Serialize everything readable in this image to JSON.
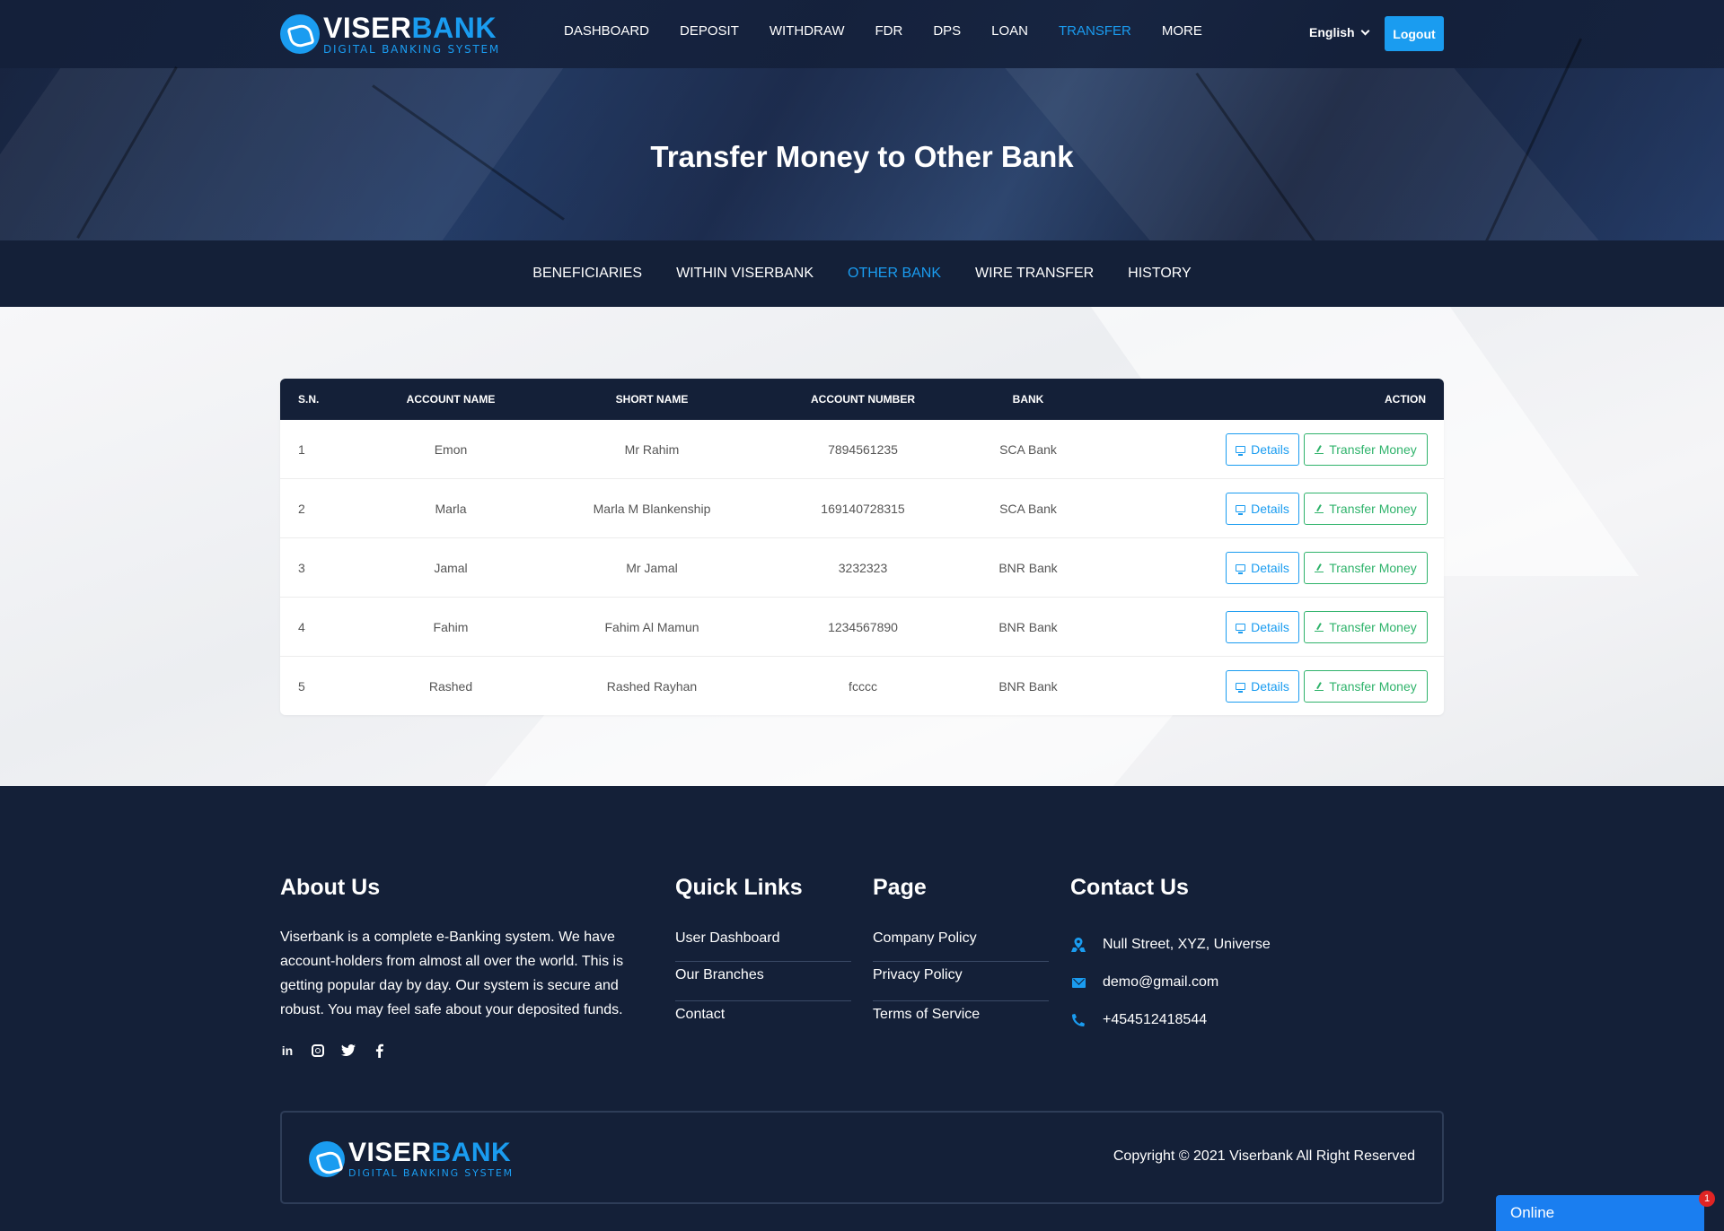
{
  "brand": {
    "word1": "VISER",
    "word2": "BANK",
    "tagline": "DIGITAL BANKING SYSTEM",
    "accent": "#1a9cf0",
    "navy": "#142038",
    "green": "#2fb36b"
  },
  "nav": {
    "items": [
      "DASHBOARD",
      "DEPOSIT",
      "WITHDRAW",
      "FDR",
      "DPS",
      "LOAN",
      "TRANSFER",
      "MORE"
    ],
    "active": "TRANSFER"
  },
  "language": {
    "selected": "English"
  },
  "logout_label": "Logout",
  "hero": {
    "title": "Transfer Money to Other Bank"
  },
  "subnav": {
    "items": [
      "BENEFICIARIES",
      "WITHIN VISERBANK",
      "OTHER BANK",
      "WIRE TRANSFER",
      "HISTORY"
    ],
    "active": "OTHER BANK"
  },
  "table": {
    "headers": {
      "sn": "S.N.",
      "account_name": "ACCOUNT NAME",
      "short_name": "SHORT NAME",
      "account_number": "ACCOUNT NUMBER",
      "bank": "BANK",
      "action": "ACTION"
    },
    "details_label": "Details",
    "transfer_label": "Transfer Money",
    "rows": [
      {
        "sn": "1",
        "account_name": "Emon",
        "short_name": "Mr Rahim",
        "account_number": "7894561235",
        "bank": "SCA Bank"
      },
      {
        "sn": "2",
        "account_name": "Marla",
        "short_name": "Marla M Blankenship",
        "account_number": "169140728315",
        "bank": "SCA Bank"
      },
      {
        "sn": "3",
        "account_name": "Jamal",
        "short_name": "Mr Jamal",
        "account_number": "3232323",
        "bank": "BNR Bank"
      },
      {
        "sn": "4",
        "account_name": "Fahim",
        "short_name": "Fahim Al Mamun",
        "account_number": "1234567890",
        "bank": "BNR Bank"
      },
      {
        "sn": "5",
        "account_name": "Rashed",
        "short_name": "Rashed Rayhan",
        "account_number": "fcccc",
        "bank": "BNR Bank"
      }
    ]
  },
  "footer": {
    "about": {
      "title": "About Us",
      "text": "Viserbank is a complete e-Banking system. We have account-holders from almost all over the world. This is getting popular day by day. Our system is secure and robust. You may feel safe about your deposited funds.",
      "socials": [
        "linkedin-icon",
        "instagram-icon",
        "twitter-icon",
        "facebook-icon"
      ]
    },
    "quick_links": {
      "title": "Quick Links",
      "items": [
        "User Dashboard",
        "Our Branches",
        "Contact"
      ]
    },
    "page": {
      "title": "Page",
      "items": [
        "Company Policy",
        "Privacy Policy",
        "Terms of Service"
      ]
    },
    "contact": {
      "title": "Contact Us",
      "address": "Null Street, XYZ, Universe",
      "email": "demo@gmail.com",
      "phone": "+454512418544"
    },
    "copyright": "Copyright © 2021 Viserbank All Right Reserved"
  },
  "chat": {
    "status": "Online",
    "unread": "1"
  }
}
